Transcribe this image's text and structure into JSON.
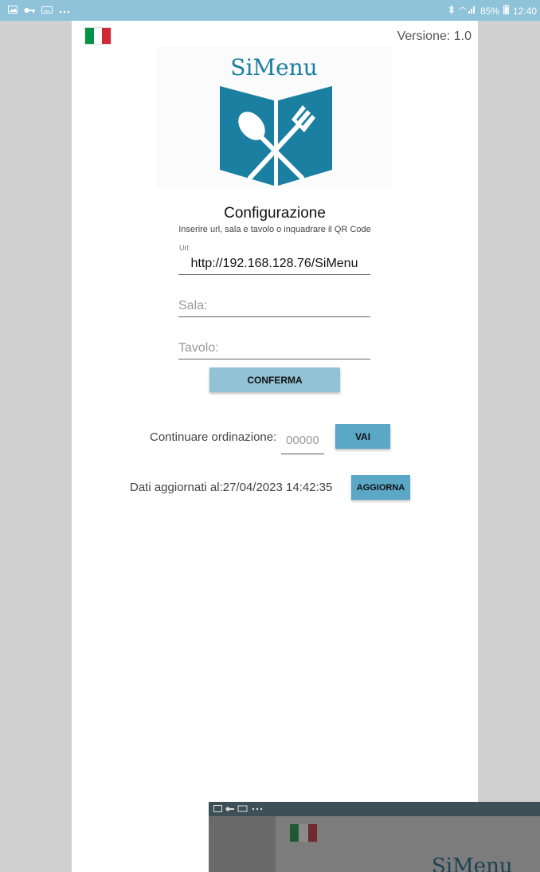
{
  "statusbar": {
    "icons": [
      "image-icon",
      "key-icon",
      "keyboard-icon",
      "more-icon",
      "bluetooth-icon",
      "signal-icon",
      "battery-icon"
    ],
    "battery": "85%",
    "time": "12:40"
  },
  "header": {
    "version": "Versione: 1.0"
  },
  "logo": {
    "title": "SiMenu",
    "color": "#1a7fa0"
  },
  "config": {
    "title": "Configurazione",
    "subtitle": "Inserire url, sala e tavolo o inquadrare il QR Code",
    "url_label": "Url:",
    "url_value": "http://192.168.128.76/SiMenu",
    "sala_placeholder": "Sala:",
    "tavolo_placeholder": "Tavolo:",
    "confirm_label": "CONFERMA"
  },
  "continue": {
    "label": "Continuare ordinazione:",
    "placeholder": "00000",
    "button": "VAI"
  },
  "update": {
    "label": "Dati aggiornati al:27/04/2023 14:42:35",
    "button": "AGGIORNA"
  },
  "thumbnail": {
    "logo": "SiMenu"
  },
  "colors": {
    "statusbar": "#8fc3d9",
    "accent": "#5ba7c6",
    "confirm": "#91c2d6",
    "flag_green": "#009246",
    "flag_red": "#ce2b37"
  }
}
